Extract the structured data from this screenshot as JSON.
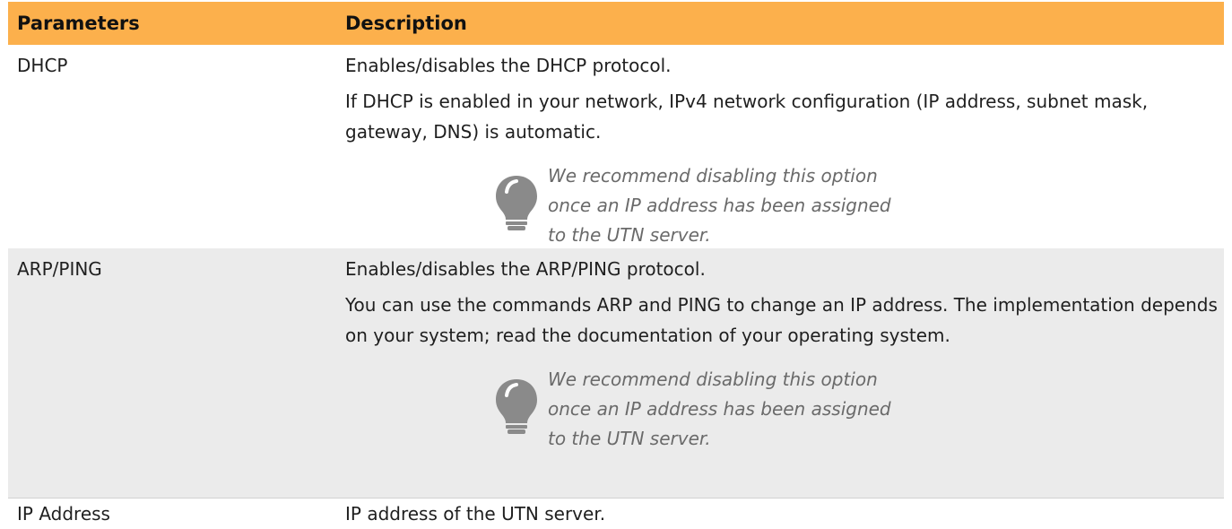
{
  "header": {
    "col1": "Parameters",
    "col2": "Description"
  },
  "rows": [
    {
      "param": "DHCP",
      "desc1": "Enables/disables the DHCP protocol.",
      "desc2": "If DHCP is enabled in your network, IPv4 network configuration (IP address, subnet mask, gateway, DNS) is automatic.",
      "tip": "We recommend disabling this option once an IP address has been assigned to the UTN server."
    },
    {
      "param": "ARP/PING",
      "desc1": "Enables/disables the ARP/PING protocol.",
      "desc2": "You can use the commands ARP and PING to change an IP address. The implementation depends on your system; read the documentation of your operating system.",
      "tip": "We recommend disabling this option once an IP address has been assigned to the UTN server."
    },
    {
      "param": "IP Address",
      "desc1": "IP address of the UTN server."
    }
  ],
  "icons": {
    "tip_icon": "lightbulb-icon"
  },
  "colors": {
    "header_bg": "#fcb04c",
    "alt_row_bg": "#ebebeb",
    "tip_text": "#6a6a6a",
    "icon": "#8a8a8a"
  }
}
